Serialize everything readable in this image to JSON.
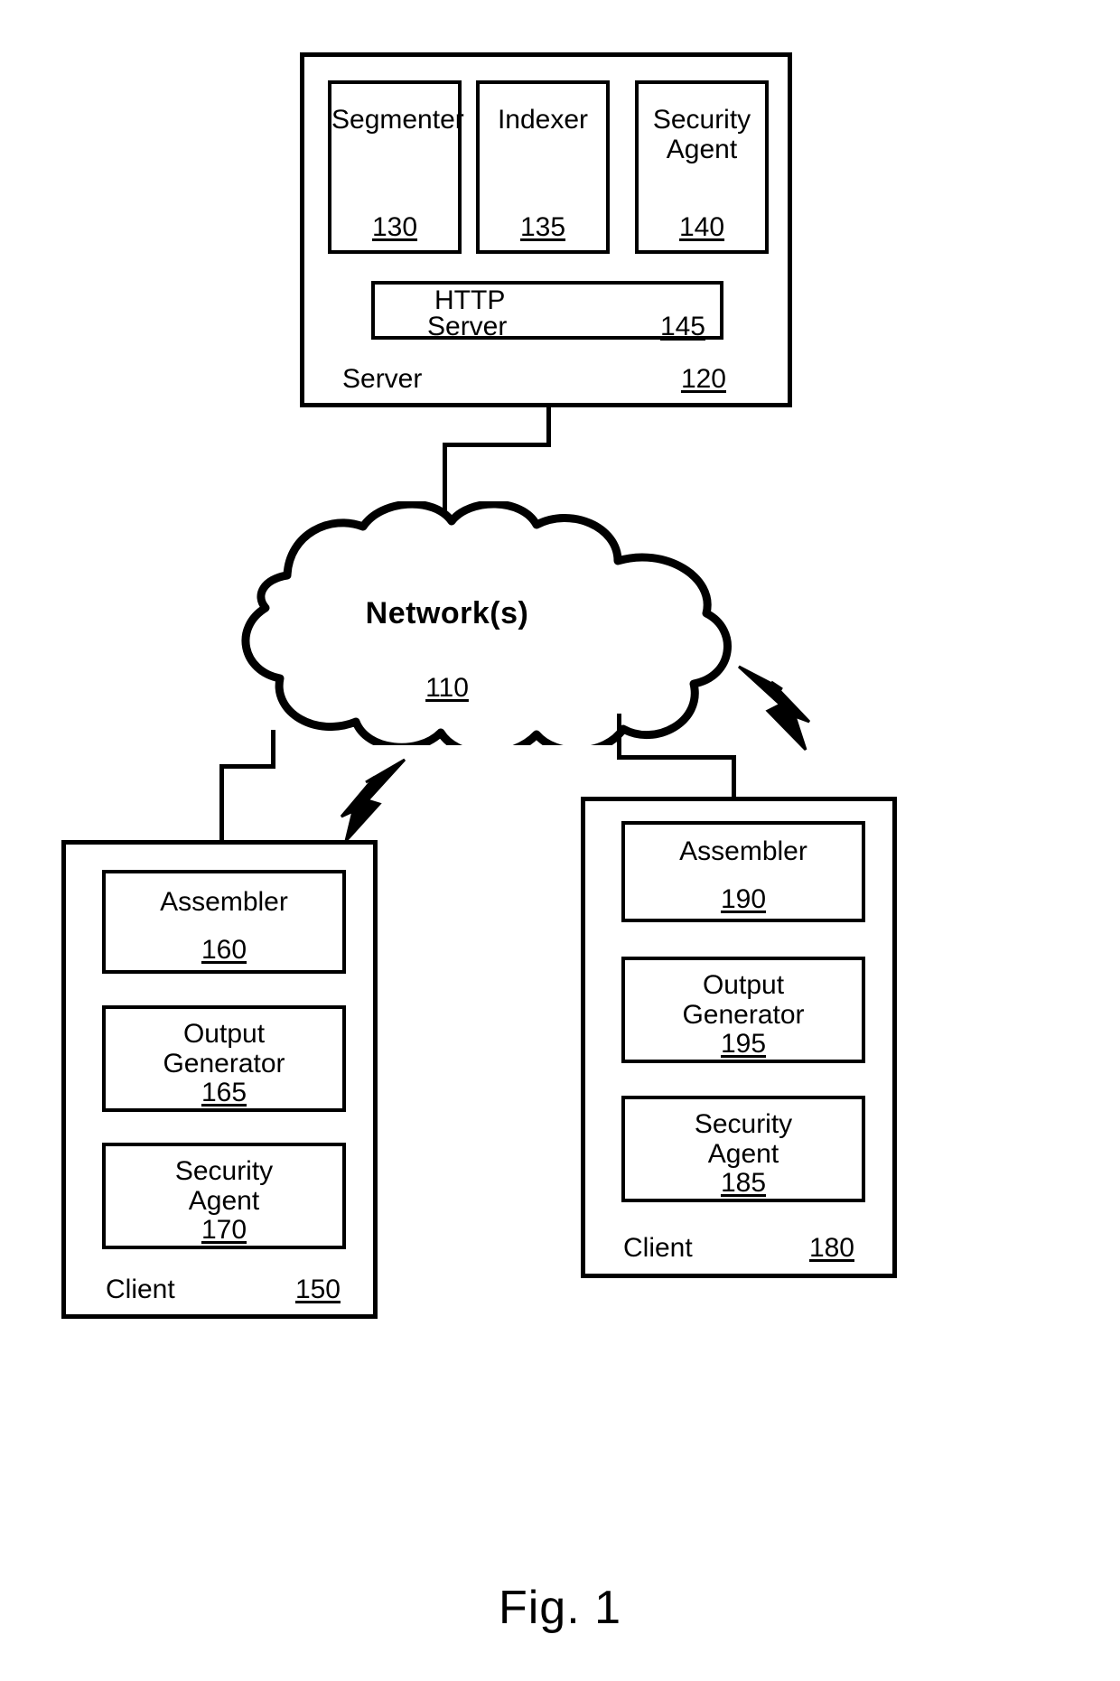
{
  "figure": {
    "caption": "Fig. 1"
  },
  "server": {
    "label": "Server",
    "ref": "120",
    "modules": [
      {
        "name": "Segmenter",
        "ref": "130"
      },
      {
        "name": "Indexer",
        "ref": "135"
      },
      {
        "name": "Security\nAgent",
        "line1": "Security",
        "line2": "Agent",
        "ref": "140"
      }
    ],
    "http_server": {
      "line1": "HTTP",
      "line2": "Server",
      "ref": "145"
    }
  },
  "network": {
    "label": "Network(s)",
    "ref": "110"
  },
  "client_left": {
    "label": "Client",
    "ref": "150",
    "modules": [
      {
        "line1": "Assembler",
        "line2": "",
        "ref": "160"
      },
      {
        "line1": "Output",
        "line2": "Generator",
        "ref": "165"
      },
      {
        "line1": "Security",
        "line2": "Agent",
        "ref": "170"
      }
    ]
  },
  "client_right": {
    "label": "Client",
    "ref": "180",
    "modules": [
      {
        "line1": "Assembler",
        "line2": "",
        "ref": "190"
      },
      {
        "line1": "Output",
        "line2": "Generator",
        "ref": "195"
      },
      {
        "line1": "Security",
        "line2": "Agent",
        "ref": "185"
      }
    ]
  },
  "icons": {
    "wireless_left": "lightning-bolt-icon",
    "wireless_right": "lightning-bolt-icon"
  }
}
